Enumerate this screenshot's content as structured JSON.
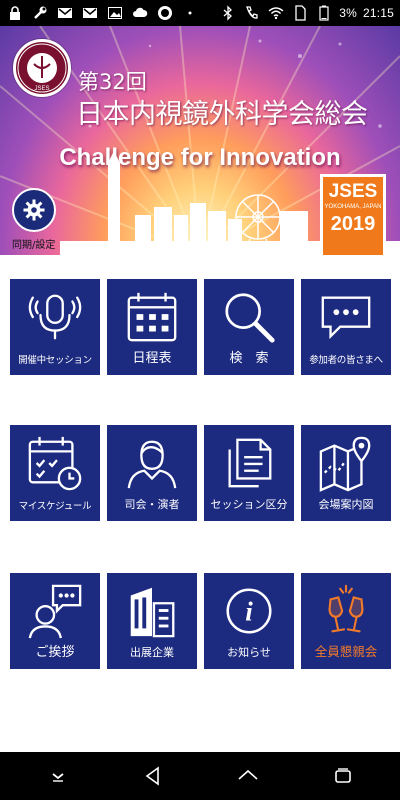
{
  "status_bar": {
    "battery": "3%",
    "time": "21:15",
    "left_icons": [
      "lock-icon",
      "wrench-icon",
      "gmail-icon",
      "gmail-icon",
      "image-icon",
      "cloud-icon",
      "record-icon",
      "more-dots-icon"
    ],
    "right_icons": [
      "bluetooth-icon",
      "phone-icon",
      "wifi-icon",
      "sim-icon",
      "battery-icon"
    ]
  },
  "banner": {
    "emblem_text": "JSES",
    "conf_number": "第32回",
    "conf_title": "日本内視鏡外科学会総会",
    "tagline": "Challenge for Innovation",
    "badge": {
      "name": "JSES",
      "location": "YOKOHAMA, JAPAN",
      "year": "2019"
    },
    "sync_label": "同期/設定"
  },
  "menu": [
    {
      "label": "開催中セッション",
      "icon": "microphone-icon"
    },
    {
      "label": "日程表",
      "icon": "calendar-icon"
    },
    {
      "label": "検　索",
      "icon": "search-icon"
    },
    {
      "label": "参加者の皆さまへ",
      "icon": "chat-bubble-icon"
    },
    {
      "label": "マイスケジュール",
      "icon": "calendar-clock-icon"
    },
    {
      "label": "司会・演者",
      "icon": "person-icon"
    },
    {
      "label": "セッション区分",
      "icon": "documents-icon"
    },
    {
      "label": "会場案内図",
      "icon": "map-icon"
    },
    {
      "label": "ご挨拶",
      "icon": "greeting-person-icon"
    },
    {
      "label": "出展企業",
      "icon": "building-icon"
    },
    {
      "label": "お知らせ",
      "icon": "info-icon"
    },
    {
      "label": "全員懇親会",
      "icon": "champagne-icon"
    }
  ],
  "colors": {
    "tile_bg": "#1c2a80",
    "accent_orange": "#f07a2a",
    "badge_orange": "#f07a1b"
  }
}
